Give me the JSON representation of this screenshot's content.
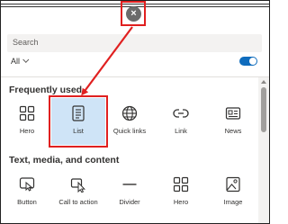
{
  "toolbox": {
    "close_label": "×",
    "search_placeholder": "Search",
    "filter_value": "All",
    "sections": [
      {
        "title": "Frequently used",
        "items": [
          {
            "label": "Hero",
            "icon": "hero-icon"
          },
          {
            "label": "List",
            "icon": "list-icon",
            "selected": true
          },
          {
            "label": "Quick links",
            "icon": "globe-icon"
          },
          {
            "label": "Link",
            "icon": "link-icon"
          },
          {
            "label": "News",
            "icon": "news-icon"
          }
        ]
      },
      {
        "title": "Text, media, and content",
        "items": [
          {
            "label": "Button",
            "icon": "button-tap-icon"
          },
          {
            "label": "Call to action",
            "icon": "cursor-icon"
          },
          {
            "label": "Divider",
            "icon": "divider-icon"
          },
          {
            "label": "Hero",
            "icon": "hero-icon"
          },
          {
            "label": "Image",
            "icon": "image-icon"
          }
        ]
      }
    ]
  },
  "colors": {
    "accent": "#0f6cbd",
    "selected_bg": "#cfe4f7",
    "annotation": "#e02020"
  }
}
